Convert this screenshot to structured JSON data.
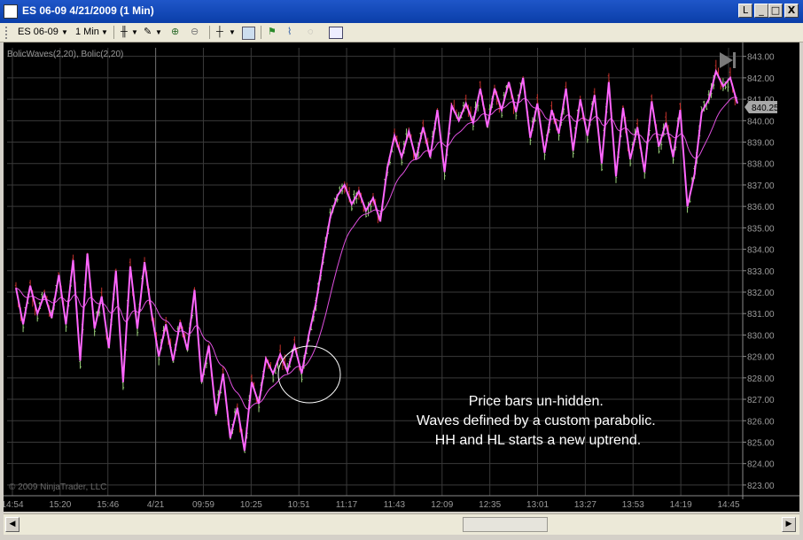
{
  "window": {
    "title": "ES 06-09  4/21/2009 (1 Min)",
    "buttons": [
      "L",
      "_",
      "□",
      "X"
    ]
  },
  "toolbar": {
    "instrument": "ES 06-09",
    "interval": "1 Min"
  },
  "chart": {
    "indicator_label": "BolicWaves(2,20), Bolic(2,20)",
    "copyright": "© 2009 NinjaTrader, LLC",
    "current_price": "840.25",
    "annotation_lines": [
      "Price bars un-hidden.",
      "Waves defined by a custom parabolic.",
      "HH and HL starts a new uptrend."
    ],
    "colors": {
      "background": "#000000",
      "grid": "#3a3a3a",
      "up_bar": "#9ad17a",
      "down_bar": "#c0302a",
      "wave": "#ff66ff",
      "parabolic": "#e050e0",
      "highlight_circle": "#ffffff"
    }
  },
  "chart_data": {
    "type": "line",
    "y_ticks": [
      "843.00",
      "842.00",
      "841.00",
      "840.00",
      "839.00",
      "838.00",
      "837.00",
      "836.00",
      "835.00",
      "834.00",
      "833.00",
      "832.00",
      "831.00",
      "830.00",
      "829.00",
      "828.00",
      "827.00",
      "826.00",
      "825.00",
      "824.00",
      "823.00"
    ],
    "x_ticks": [
      "14:54",
      "15:20",
      "15:46",
      "4/21",
      "09:59",
      "10:25",
      "10:51",
      "11:17",
      "11:43",
      "12:09",
      "12:35",
      "13:01",
      "13:27",
      "13:53",
      "14:19",
      "14:45"
    ],
    "ylim": [
      822.5,
      843.4
    ],
    "series": [
      {
        "values": [
          832.2,
          830.5,
          832.3,
          831.0,
          831.9,
          830.8,
          832.8,
          830.5,
          833.5,
          828.8,
          833.8,
          830.3,
          831.8,
          829.4,
          833.0,
          827.8,
          833.2,
          830.3,
          833.4,
          831.0,
          829.0,
          830.5,
          828.8,
          830.6,
          829.3,
          832.1,
          827.8,
          829.5,
          826.3,
          828.2,
          825.2,
          826.6,
          824.6,
          827.8,
          826.8,
          828.9,
          828.2,
          829.1,
          828.3,
          829.5,
          828.2,
          830.0,
          831.5,
          833.6,
          835.5,
          836.5,
          837.0,
          836.1,
          836.7,
          835.8,
          836.4,
          835.3,
          837.8,
          839.3,
          838.3,
          839.5,
          838.2,
          839.7,
          838.3,
          840.5,
          837.6,
          840.7,
          840.0,
          840.8,
          839.9,
          841.5,
          839.7,
          841.5,
          840.5,
          841.8,
          840.4,
          842.0,
          839.2,
          840.8,
          838.5,
          840.5,
          839.4,
          841.5,
          838.6,
          841.0,
          839.3,
          841.2,
          838.0,
          841.8,
          837.4,
          840.6,
          838.2,
          839.7,
          837.6,
          840.9,
          838.8,
          839.9,
          838.3,
          840.5,
          836.0,
          837.5,
          840.4,
          841.0,
          842.3,
          841.6,
          842.0,
          840.8
        ]
      }
    ]
  }
}
